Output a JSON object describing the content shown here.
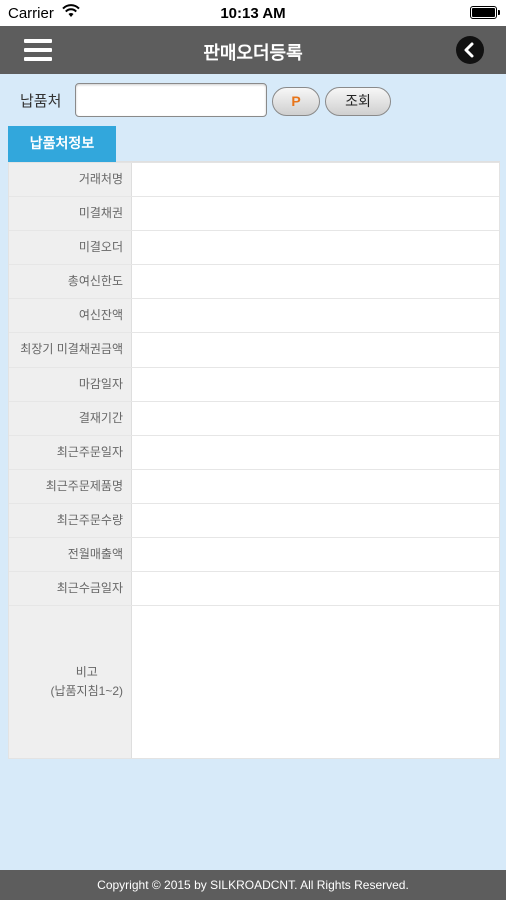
{
  "status_bar": {
    "carrier": "Carrier",
    "time": "10:13 AM"
  },
  "nav": {
    "title": "판매오더등록"
  },
  "search": {
    "label": "납품처",
    "value": "",
    "p_button": "P",
    "query_button": "조회"
  },
  "tabs": [
    {
      "label": "납품처정보",
      "active": true
    }
  ],
  "info_rows": [
    {
      "label": "거래처명",
      "value": ""
    },
    {
      "label": "미결채권",
      "value": ""
    },
    {
      "label": "미결오더",
      "value": ""
    },
    {
      "label": "총여신한도",
      "value": ""
    },
    {
      "label": "여신잔액",
      "value": ""
    },
    {
      "label": "최장기 미결채권금액",
      "value": ""
    },
    {
      "label": "마감일자",
      "value": ""
    },
    {
      "label": "결재기간",
      "value": ""
    },
    {
      "label": "최근주문일자",
      "value": ""
    },
    {
      "label": "최근주문제품명",
      "value": ""
    },
    {
      "label": "최근주문수량",
      "value": ""
    },
    {
      "label": "전월매출액",
      "value": ""
    },
    {
      "label": "최근수금일자",
      "value": ""
    }
  ],
  "remarks": {
    "label_line1": "비고",
    "label_line2": "(납품지침1~2)",
    "value": ""
  },
  "footer": {
    "copyright": "Copyright © 2015 by SILKROADCNT. All Rights Reserved."
  },
  "colors": {
    "nav_bg": "#5d5d5d",
    "tab_active": "#32a7dc",
    "page_bg": "#d7eaf9",
    "p_button_text": "#e8751a"
  },
  "icons": {
    "menu": "hamburger-icon",
    "back": "chevron-left-icon",
    "wifi": "wifi-icon",
    "battery": "battery-icon"
  }
}
